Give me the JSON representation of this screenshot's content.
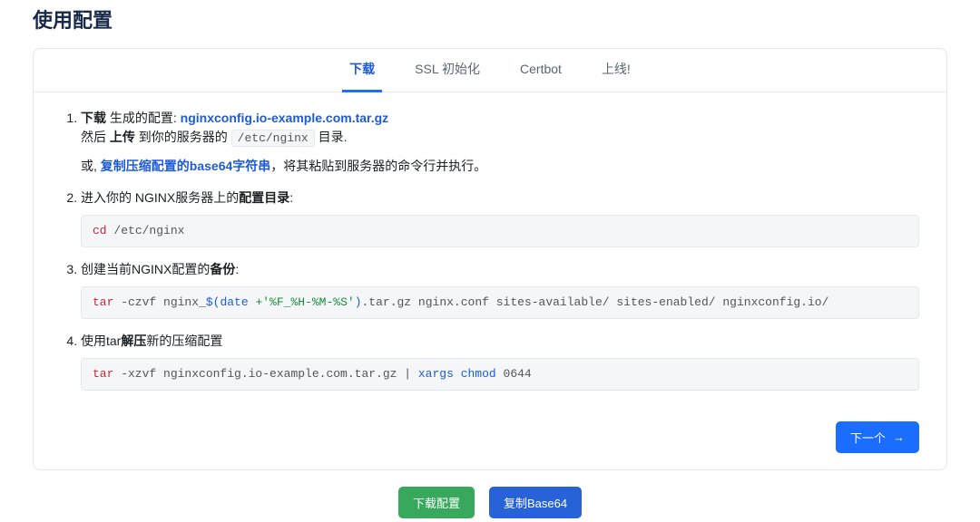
{
  "title": "使用配置",
  "tabs": [
    {
      "label": "下载",
      "active": true
    },
    {
      "label": "SSL 初始化",
      "active": false
    },
    {
      "label": "Certbot",
      "active": false
    },
    {
      "label": "上线!",
      "active": false
    }
  ],
  "step1": {
    "download_b": "下载",
    "gen_cfg": " 生成的配置: ",
    "archive_link": "nginxconfig.io-example.com.tar.gz",
    "then_upload_pre": "然后 ",
    "upload_b": "上传",
    "to_server": " 到你的服务器的 ",
    "path": "/etc/nginx",
    "dir_period": " 目录.",
    "or_prefix": "或, ",
    "copy_b64_link": "复制压缩配置的base64字符串",
    "or_suffix": "，将其粘贴到服务器的命令行并执行。"
  },
  "step2": {
    "pre": "进入你的 NGINX服务器上的",
    "b": "配置目录",
    "post": ":",
    "code": {
      "cmd": "cd",
      "rest": " /etc/nginx"
    }
  },
  "step3": {
    "pre": "创建当前NGINX配置的",
    "b": "备份",
    "post": ":",
    "code": {
      "cmd": "tar",
      "a": " -czvf nginx_",
      "id1": "$(",
      "id2": "date",
      "str": " +'%F_%H-%M-%S'",
      "id3": ")",
      "b2": ".tar.gz nginx.conf sites-available/ sites-enabled/ nginxconfig.io/"
    }
  },
  "step4": {
    "pre": "使用tar",
    "b": "解压",
    "post": "新的压缩配置",
    "code": {
      "cmd": "tar",
      "a": " -xzvf nginxconfig.io-example.com.tar.gz | ",
      "id1": "xargs",
      "sp": " ",
      "id2": "chmod",
      "b2": " 0644"
    }
  },
  "next_btn": "下一个",
  "next_arrow": "→",
  "footer": {
    "download": "下载配置",
    "copy_b64": "复制Base64"
  }
}
